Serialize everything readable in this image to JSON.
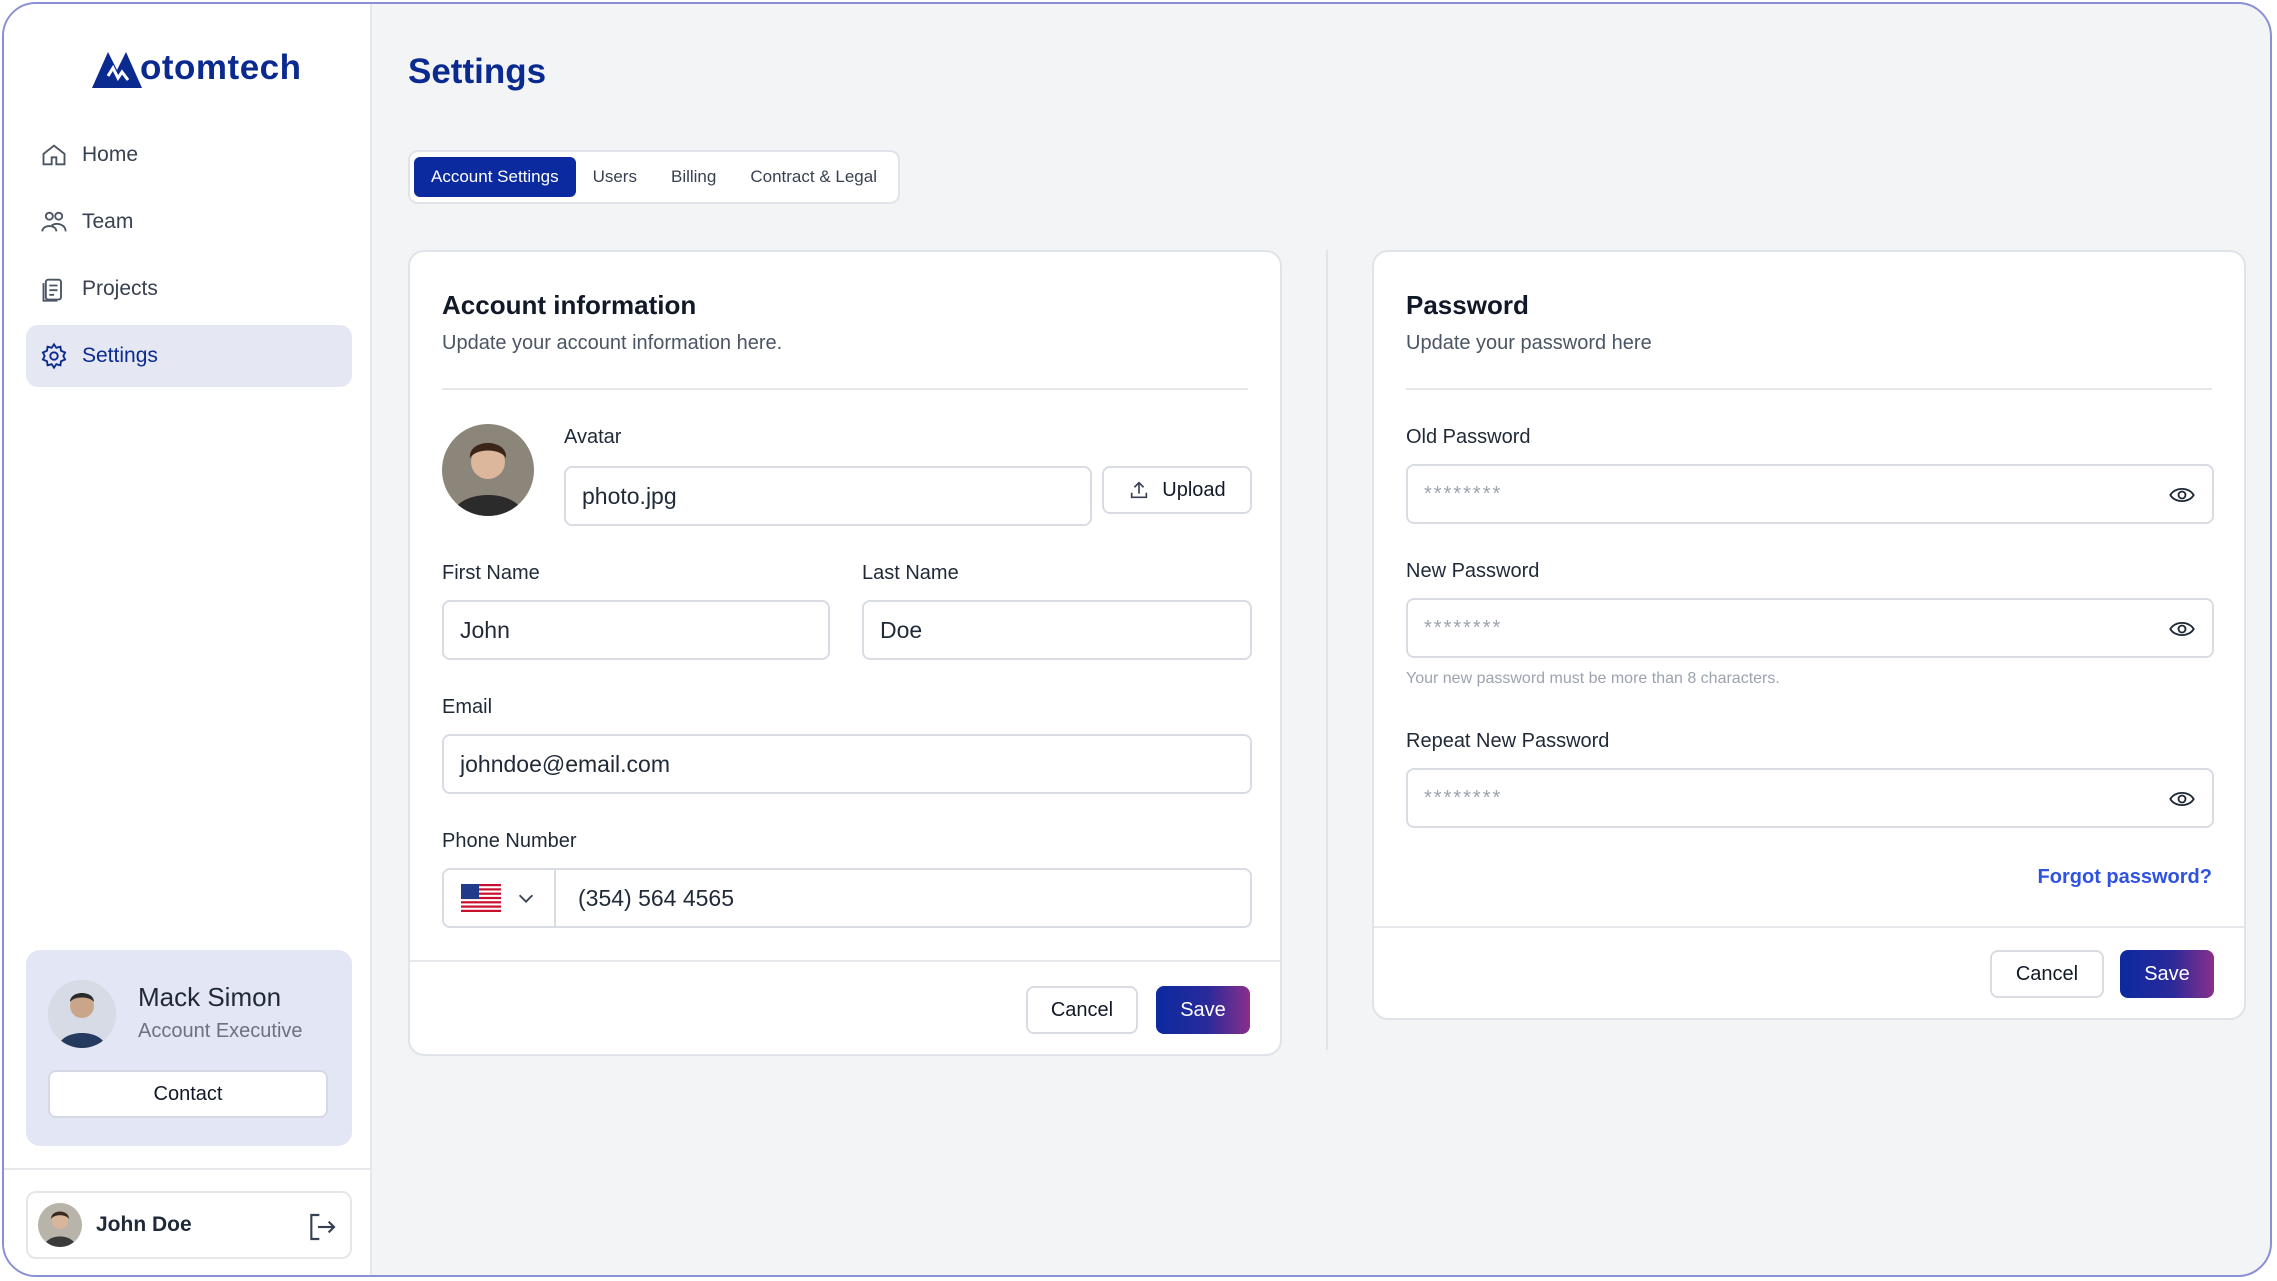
{
  "brand": {
    "name": "otomtech"
  },
  "sidebar": {
    "items": [
      {
        "label": "Home",
        "icon": "home-icon"
      },
      {
        "label": "Team",
        "icon": "team-icon"
      },
      {
        "label": "Projects",
        "icon": "projects-icon"
      },
      {
        "label": "Settings",
        "icon": "gear-icon",
        "active": true
      }
    ],
    "profile_card": {
      "name": "Mack Simon",
      "role": "Account Executive",
      "contact_label": "Contact"
    },
    "user": {
      "name": "John Doe"
    }
  },
  "page": {
    "title": "Settings"
  },
  "tabs": [
    {
      "label": "Account Settings",
      "active": true
    },
    {
      "label": "Users"
    },
    {
      "label": "Billing"
    },
    {
      "label": "Contract & Legal"
    }
  ],
  "account": {
    "title": "Account information",
    "subtitle": "Update your account information here.",
    "avatar_label": "Avatar",
    "avatar_file": "photo.jpg",
    "upload_label": "Upload",
    "first_name_label": "First Name",
    "first_name": "John",
    "last_name_label": "Last Name",
    "last_name": "Doe",
    "email_label": "Email",
    "email": "johndoe@email.com",
    "phone_label": "Phone Number",
    "phone": "(354) 564 4565",
    "cancel_label": "Cancel",
    "save_label": "Save"
  },
  "password": {
    "title": "Password",
    "subtitle": "Update your password here",
    "old_label": "Old Password",
    "old_value": "********",
    "new_label": "New Password",
    "new_value": "********",
    "hint": "Your new password must be more than 8 characters.",
    "repeat_label": "Repeat New Password",
    "repeat_value": "********",
    "forgot_label": "Forgot password?",
    "cancel_label": "Cancel",
    "save_label": "Save"
  },
  "colors": {
    "primary": "#0b2a9f",
    "accent_end": "#8a2f8a",
    "link": "#2f52e0",
    "active_bg": "#e5e7f3"
  }
}
